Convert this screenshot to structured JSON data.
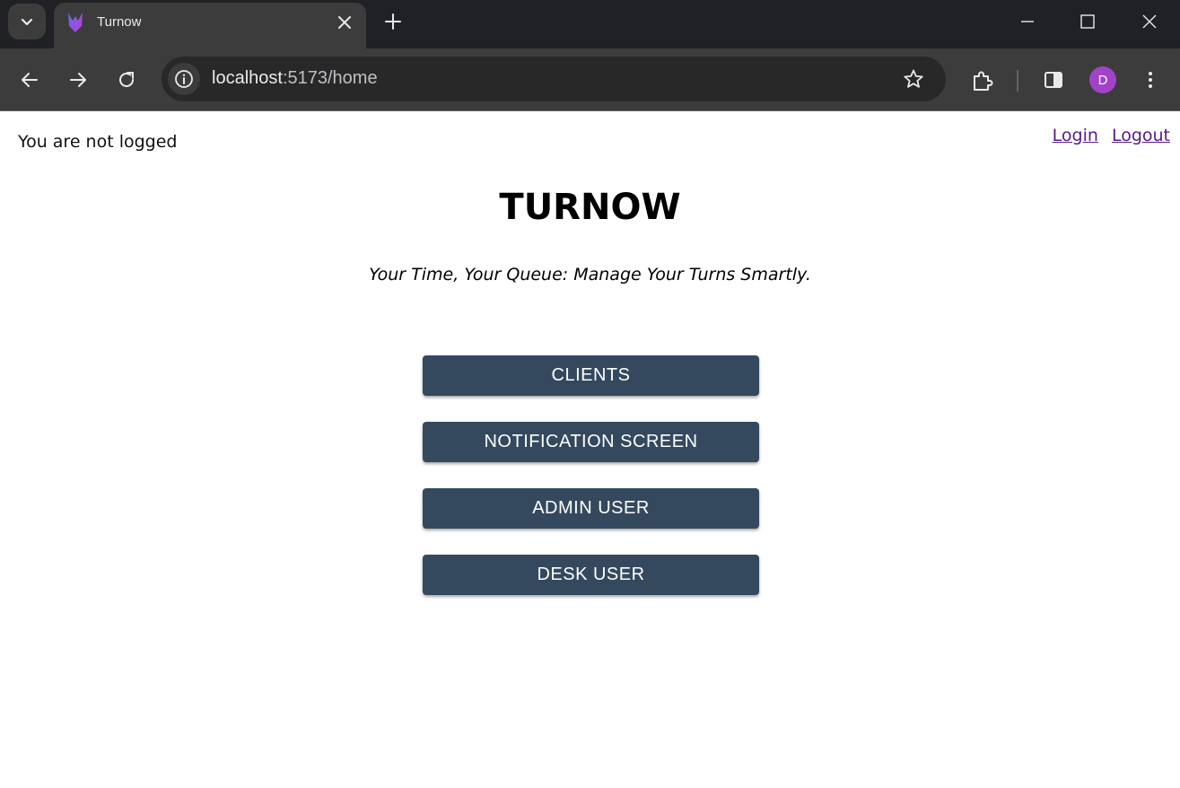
{
  "browser": {
    "tab_title": "Turnow",
    "url_host": "localhost",
    "url_path": ":5173/home",
    "profile_initial": "D",
    "profile_color": "#a142c9",
    "icons": {
      "tab_search": "chevron-down-icon",
      "favicon": "turnow-logo-icon",
      "tab_close": "close-icon",
      "new_tab": "plus-icon",
      "back": "arrow-left-icon",
      "forward": "arrow-right-icon",
      "reload": "reload-icon",
      "site_info": "info-icon",
      "bookmark": "star-icon",
      "extensions": "puzzle-icon",
      "side_panel": "side-panel-icon",
      "menu": "more-vertical-icon"
    }
  },
  "header": {
    "status_text": "You are not logged",
    "login_label": "Login",
    "logout_label": "Logout"
  },
  "main": {
    "title": "TURNOW",
    "tagline": "Your Time, Your Queue: Manage Your Turns Smartly.",
    "buttons": [
      {
        "label": "CLIENTS"
      },
      {
        "label": "NOTIFICATION SCREEN"
      },
      {
        "label": "ADMIN USER"
      },
      {
        "label": "DESK USER"
      }
    ],
    "button_color": "#34495e",
    "link_color": "#551a8b"
  }
}
